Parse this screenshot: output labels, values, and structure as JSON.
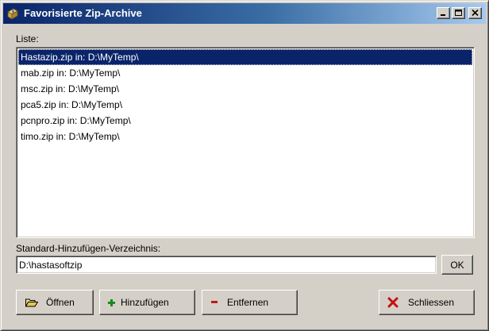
{
  "window": {
    "title": "Favorisierte Zip-Archive",
    "icon": "zip-archive-icon"
  },
  "titlebar_buttons": {
    "minimize_icon": "minimize-icon",
    "maximize_icon": "maximize-icon",
    "close_icon": "close-icon"
  },
  "list": {
    "label": "Liste:",
    "items": [
      {
        "text": "Hastazip.zip in: D:\\MyTemp\\",
        "selected": true
      },
      {
        "text": "mab.zip in: D:\\MyTemp\\",
        "selected": false
      },
      {
        "text": "msc.zip in: D:\\MyTemp\\",
        "selected": false
      },
      {
        "text": "pca5.zip in: D:\\MyTemp\\",
        "selected": false
      },
      {
        "text": "pcnpro.zip in: D:\\MyTemp\\",
        "selected": false
      },
      {
        "text": "timo.zip in: D:\\MyTemp\\",
        "selected": false
      }
    ]
  },
  "default_dir": {
    "label": "Standard-Hinzufügen-Verzeichnis:",
    "value": "D:\\hastasoftzip",
    "ok_label": "OK"
  },
  "buttons": {
    "open": {
      "label": "Öffnen",
      "icon": "folder-open-icon"
    },
    "add": {
      "label": "Hinzufügen",
      "icon": "plus-icon"
    },
    "remove": {
      "label": "Entfernen",
      "icon": "minus-icon"
    },
    "close": {
      "label": "Schliessen",
      "icon": "close-x-icon"
    }
  },
  "colors": {
    "title_gradient_start": "#0a246a",
    "title_gradient_end": "#a6caf0",
    "selection": "#0a246a",
    "face": "#d4d0c8"
  }
}
